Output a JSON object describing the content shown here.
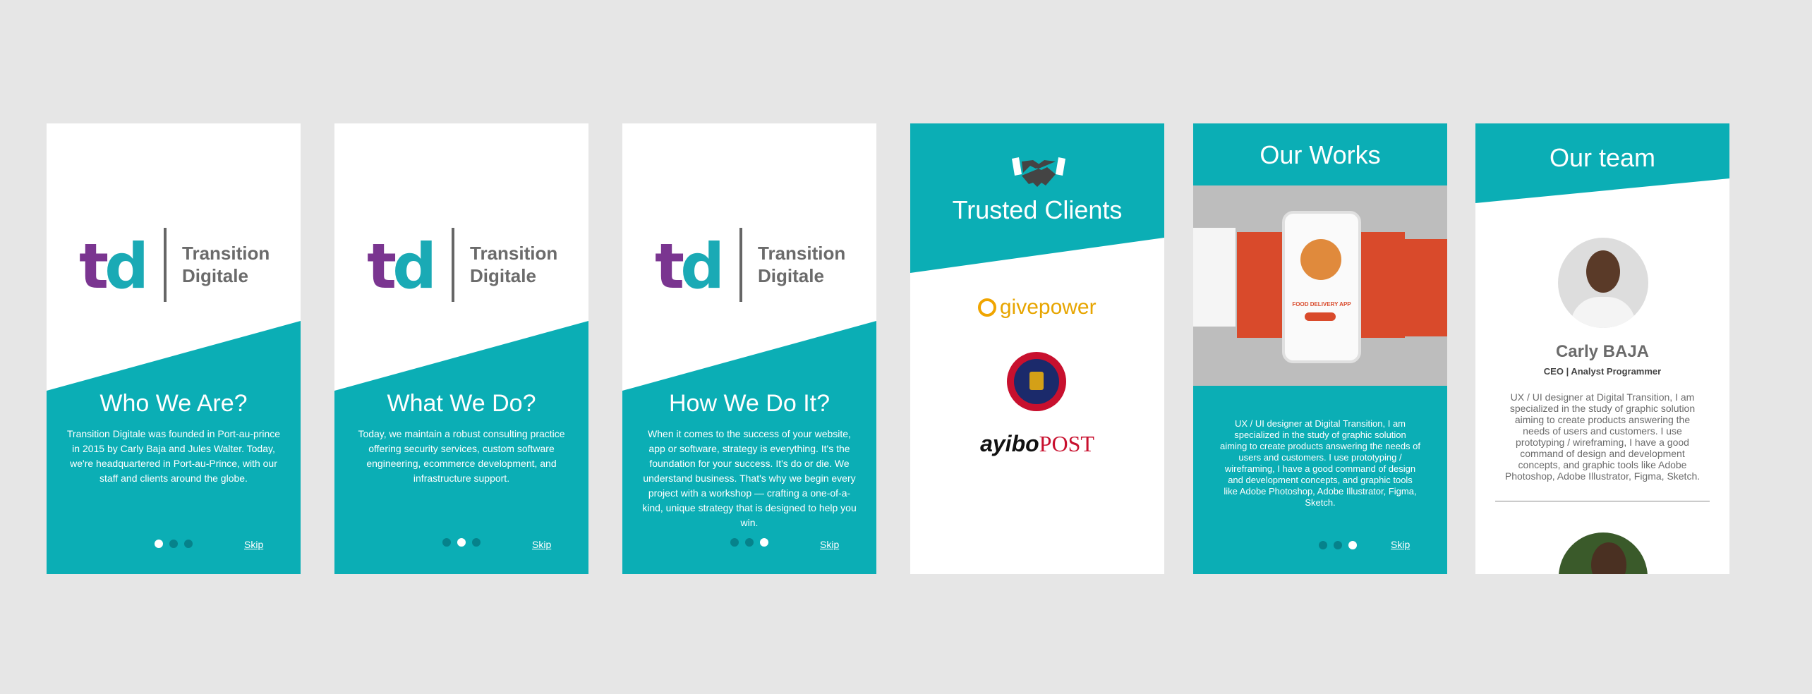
{
  "brand": {
    "logo_letters": "td",
    "logo_name_line1": "Transition",
    "logo_name_line2": "Digitale"
  },
  "colors": {
    "teal": "#0baeb5",
    "teal_dark": "#06828b",
    "purple": "#7a3590",
    "background": "#e6e6e6"
  },
  "slides": [
    {
      "title": "Who We Are?",
      "text": "Transition Digitale was founded in Port-au-prince in 2015 by Carly Baja and Jules Walter. Today, we're headquartered in Port-au-Prince, with our staff and clients around the globe.",
      "skip": "Skip",
      "active_dot": 0
    },
    {
      "title": "What We Do?",
      "text": "Today, we maintain a robust consulting practice offering security services, custom software engineering, ecommerce development, and infrastructure support.",
      "skip": "Skip",
      "active_dot": 1
    },
    {
      "title": "How We Do It?",
      "text": "When it comes to the success of your website, app or software, strategy is everything. It's the foundation for your success. It's do or die. We understand business. That's why we begin every project with a workshop — crafting a one-of-a-kind, unique strategy that is designed to help you win.",
      "skip": "Skip",
      "active_dot": 2
    }
  ],
  "clients": {
    "title": "Trusted Clients",
    "icon": "handshake-icon",
    "logos": [
      "givepower",
      "ayibo",
      "POST"
    ]
  },
  "works": {
    "title": "Our Works",
    "text": "UX / UI designer at Digital Transition, I am specialized in the study of graphic solution aiming to create products answering the needs of users and customers. I use prototyping / wireframing, I have a good command of design and development concepts, and graphic tools like Adobe Photoshop, Adobe Illustrator, Figma, Sketch.",
    "image_caption": "FOOD DELIVERY APP",
    "skip": "Skip",
    "active_dot": 2
  },
  "team": {
    "title": "Our team",
    "members": [
      {
        "name": "Carly BAJA",
        "role": "CEO | Analyst Programmer",
        "bio": "UX / UI designer at Digital Transition, I am specialized in the study of graphic solution aiming to create products answering the needs of users and customers. I use prototyping / wireframing, I have a good command of design and development concepts, and graphic tools like Adobe Photoshop, Adobe Illustrator, Figma, Sketch."
      }
    ]
  }
}
